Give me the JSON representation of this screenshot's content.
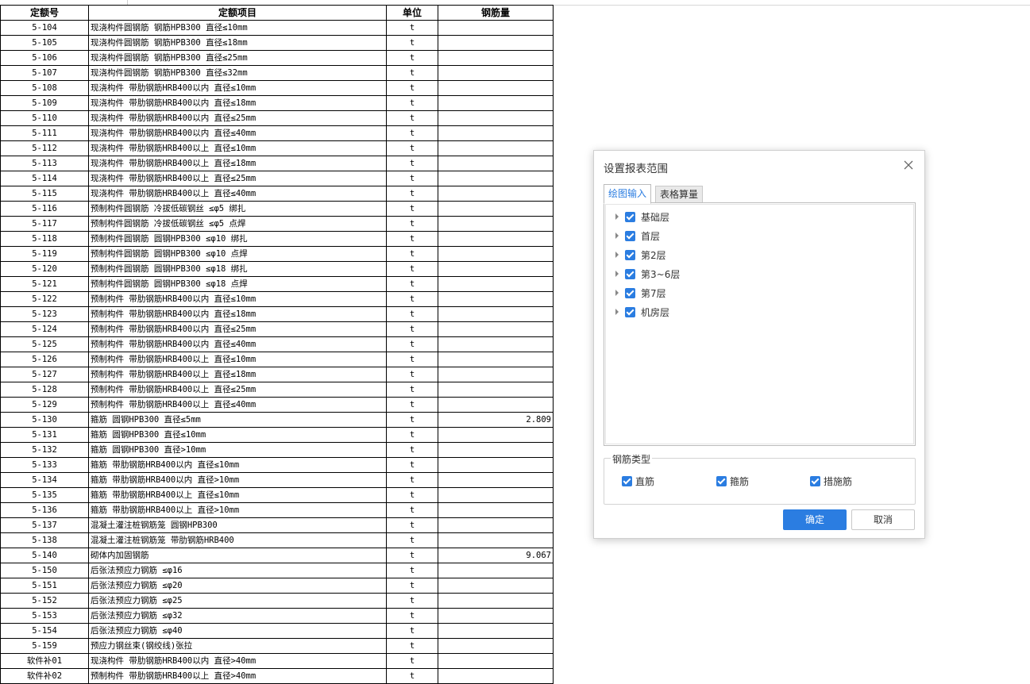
{
  "table": {
    "headers": [
      "定额号",
      "定额项目",
      "单位",
      "钢筋量"
    ],
    "rows": [
      {
        "code": "5-104",
        "item": "现浇构件圆钢筋 钢筋HPB300 直径≤10mm",
        "unit": "t",
        "qty": ""
      },
      {
        "code": "5-105",
        "item": "现浇构件圆钢筋 钢筋HPB300 直径≤18mm",
        "unit": "t",
        "qty": ""
      },
      {
        "code": "5-106",
        "item": "现浇构件圆钢筋 钢筋HPB300 直径≤25mm",
        "unit": "t",
        "qty": ""
      },
      {
        "code": "5-107",
        "item": "现浇构件圆钢筋 钢筋HPB300 直径≤32mm",
        "unit": "t",
        "qty": ""
      },
      {
        "code": "5-108",
        "item": "现浇构件 带肋钢筋HRB400以内 直径≤10mm",
        "unit": "t",
        "qty": ""
      },
      {
        "code": "5-109",
        "item": "现浇构件 带肋钢筋HRB400以内 直径≤18mm",
        "unit": "t",
        "qty": ""
      },
      {
        "code": "5-110",
        "item": "现浇构件 带肋钢筋HRB400以内 直径≤25mm",
        "unit": "t",
        "qty": ""
      },
      {
        "code": "5-111",
        "item": "现浇构件 带肋钢筋HRB400以内 直径≤40mm",
        "unit": "t",
        "qty": ""
      },
      {
        "code": "5-112",
        "item": "现浇构件 带肋钢筋HRB400以上 直径≤10mm",
        "unit": "t",
        "qty": ""
      },
      {
        "code": "5-113",
        "item": "现浇构件 带肋钢筋HRB400以上 直径≤18mm",
        "unit": "t",
        "qty": ""
      },
      {
        "code": "5-114",
        "item": "现浇构件 带肋钢筋HRB400以上 直径≤25mm",
        "unit": "t",
        "qty": ""
      },
      {
        "code": "5-115",
        "item": "现浇构件 带肋钢筋HRB400以上 直径≤40mm",
        "unit": "t",
        "qty": ""
      },
      {
        "code": "5-116",
        "item": "预制构件圆钢筋 冷拔低碳钢丝 ≤φ5 绑扎",
        "unit": "t",
        "qty": ""
      },
      {
        "code": "5-117",
        "item": "预制构件圆钢筋 冷拔低碳钢丝 ≤φ5 点焊",
        "unit": "t",
        "qty": ""
      },
      {
        "code": "5-118",
        "item": "预制构件圆钢筋 圆钢HPB300 ≤φ10 绑扎",
        "unit": "t",
        "qty": ""
      },
      {
        "code": "5-119",
        "item": "预制构件圆钢筋 圆钢HPB300 ≤φ10 点焊",
        "unit": "t",
        "qty": ""
      },
      {
        "code": "5-120",
        "item": "预制构件圆钢筋 圆钢HPB300 ≤φ18 绑扎",
        "unit": "t",
        "qty": ""
      },
      {
        "code": "5-121",
        "item": "预制构件圆钢筋 圆钢HPB300 ≤φ18 点焊",
        "unit": "t",
        "qty": ""
      },
      {
        "code": "5-122",
        "item": "预制构件 带肋钢筋HRB400以内 直径≤10mm",
        "unit": "t",
        "qty": ""
      },
      {
        "code": "5-123",
        "item": "预制构件 带肋钢筋HRB400以内 直径≤18mm",
        "unit": "t",
        "qty": ""
      },
      {
        "code": "5-124",
        "item": "预制构件 带肋钢筋HRB400以内 直径≤25mm",
        "unit": "t",
        "qty": ""
      },
      {
        "code": "5-125",
        "item": "预制构件 带肋钢筋HRB400以内 直径≤40mm",
        "unit": "t",
        "qty": ""
      },
      {
        "code": "5-126",
        "item": "预制构件 带肋钢筋HRB400以上 直径≤10mm",
        "unit": "t",
        "qty": ""
      },
      {
        "code": "5-127",
        "item": "预制构件 带肋钢筋HRB400以上 直径≤18mm",
        "unit": "t",
        "qty": ""
      },
      {
        "code": "5-128",
        "item": "预制构件 带肋钢筋HRB400以上 直径≤25mm",
        "unit": "t",
        "qty": ""
      },
      {
        "code": "5-129",
        "item": "预制构件 带肋钢筋HRB400以上 直径≤40mm",
        "unit": "t",
        "qty": ""
      },
      {
        "code": "5-130",
        "item": "箍筋 圆钢HPB300 直径≤5mm",
        "unit": "t",
        "qty": "2.809"
      },
      {
        "code": "5-131",
        "item": "箍筋 圆钢HPB300 直径≤10mm",
        "unit": "t",
        "qty": ""
      },
      {
        "code": "5-132",
        "item": "箍筋 圆钢HPB300 直径>10mm",
        "unit": "t",
        "qty": ""
      },
      {
        "code": "5-133",
        "item": "箍筋 带肋钢筋HRB400以内 直径≤10mm",
        "unit": "t",
        "qty": ""
      },
      {
        "code": "5-134",
        "item": "箍筋 带肋钢筋HRB400以内 直径>10mm",
        "unit": "t",
        "qty": ""
      },
      {
        "code": "5-135",
        "item": "箍筋 带肋钢筋HRB400以上 直径≤10mm",
        "unit": "t",
        "qty": ""
      },
      {
        "code": "5-136",
        "item": "箍筋 带肋钢筋HRB400以上 直径>10mm",
        "unit": "t",
        "qty": ""
      },
      {
        "code": "5-137",
        "item": "混凝土灌注桩钢筋笼 圆钢HPB300",
        "unit": "t",
        "qty": ""
      },
      {
        "code": "5-138",
        "item": "混凝土灌注桩钢筋笼 带肋钢筋HRB400",
        "unit": "t",
        "qty": ""
      },
      {
        "code": "5-140",
        "item": "砌体内加固钢筋",
        "unit": "t",
        "qty": "9.067"
      },
      {
        "code": "5-150",
        "item": "后张法预应力钢筋 ≤φ16",
        "unit": "t",
        "qty": ""
      },
      {
        "code": "5-151",
        "item": "后张法预应力钢筋 ≤φ20",
        "unit": "t",
        "qty": ""
      },
      {
        "code": "5-152",
        "item": "后张法预应力钢筋 ≤φ25",
        "unit": "t",
        "qty": ""
      },
      {
        "code": "5-153",
        "item": "后张法预应力钢筋 ≤φ32",
        "unit": "t",
        "qty": ""
      },
      {
        "code": "5-154",
        "item": "后张法预应力钢筋 ≤φ40",
        "unit": "t",
        "qty": ""
      },
      {
        "code": "5-159",
        "item": "预应力钢丝束(钢绞线)张拉",
        "unit": "t",
        "qty": ""
      },
      {
        "code": "软件补01",
        "item": "现浇构件 带肋钢筋HRB400以内 直径>40mm",
        "unit": "t",
        "qty": ""
      },
      {
        "code": "软件补02",
        "item": "预制构件 带肋钢筋HRB400以上 直径>40mm",
        "unit": "t",
        "qty": ""
      }
    ]
  },
  "dialog": {
    "title": "设置报表范围",
    "close_icon": "close-icon",
    "tabs": [
      {
        "label": "绘图输入",
        "active": true
      },
      {
        "label": "表格算量",
        "active": false
      }
    ],
    "floors": [
      {
        "label": "基础层",
        "checked": true
      },
      {
        "label": "首层",
        "checked": true
      },
      {
        "label": "第2层",
        "checked": true
      },
      {
        "label": "第3~6层",
        "checked": true
      },
      {
        "label": "第7层",
        "checked": true
      },
      {
        "label": "机房层",
        "checked": true
      }
    ],
    "rebar_group": {
      "legend": "钢筋类型",
      "items": [
        {
          "label": "直筋",
          "checked": true
        },
        {
          "label": "箍筋",
          "checked": true
        },
        {
          "label": "措施筋",
          "checked": true
        }
      ]
    },
    "ok_label": "确定",
    "cancel_label": "取消",
    "accent_color": "#2b7de1"
  }
}
